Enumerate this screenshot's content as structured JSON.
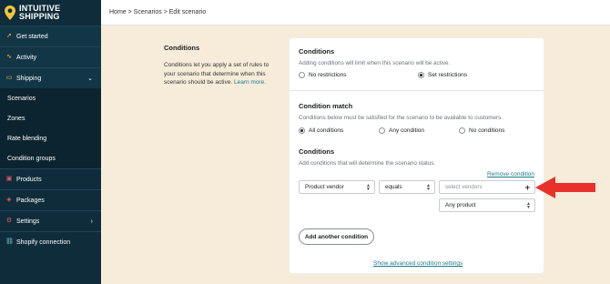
{
  "brand": {
    "line1": "INTUITIVE",
    "line2": "SHIPPING",
    "accent": "#f3c53c"
  },
  "sidebar": {
    "items": [
      {
        "label": "Get started",
        "icon": "rocket-icon"
      },
      {
        "label": "Activity",
        "icon": "activity-icon"
      },
      {
        "label": "Shipping",
        "icon": "truck-icon"
      },
      {
        "label": "Scenarios"
      },
      {
        "label": "Zones"
      },
      {
        "label": "Rate blending"
      },
      {
        "label": "Condition groups"
      },
      {
        "label": "Products",
        "icon": "box-icon"
      },
      {
        "label": "Packages",
        "icon": "package-icon"
      },
      {
        "label": "Settings",
        "icon": "gear-icon"
      },
      {
        "label": "Shopify connection",
        "icon": "link-icon"
      }
    ]
  },
  "breadcrumb": "Home > Scenarios > Edit scenario",
  "description": {
    "title": "Conditions",
    "text": "Conditions let you apply a set of rules to your scenario that determine when this scenario should be active.",
    "learn_more": "Learn more."
  },
  "card": {
    "conditions": {
      "title": "Conditions",
      "hint": "Adding conditions will limit when this scenario will be active.",
      "options": [
        "No restrictions",
        "Set restrictions"
      ],
      "selected": "Set restrictions"
    },
    "match": {
      "title": "Condition match",
      "hint": "Conditions below must be satisfied for the scenario to be available to customers.",
      "options": [
        "All conditions",
        "Any condition",
        "No conditions"
      ],
      "selected": "All conditions"
    },
    "rules": {
      "title": "Conditions",
      "hint": "Add conditions that will determine the scenario status.",
      "remove": "Remove condition",
      "field": "Product vendor",
      "operator": "equals",
      "value_placeholder": "select vendors",
      "product_scope": "Any product",
      "add_button": "Add another condition",
      "advanced_link": "Show advanced condition settings"
    }
  },
  "colors": {
    "arrow": "#e8312a",
    "link": "#1c7a8c",
    "sidebar": "#0f2c3a"
  }
}
